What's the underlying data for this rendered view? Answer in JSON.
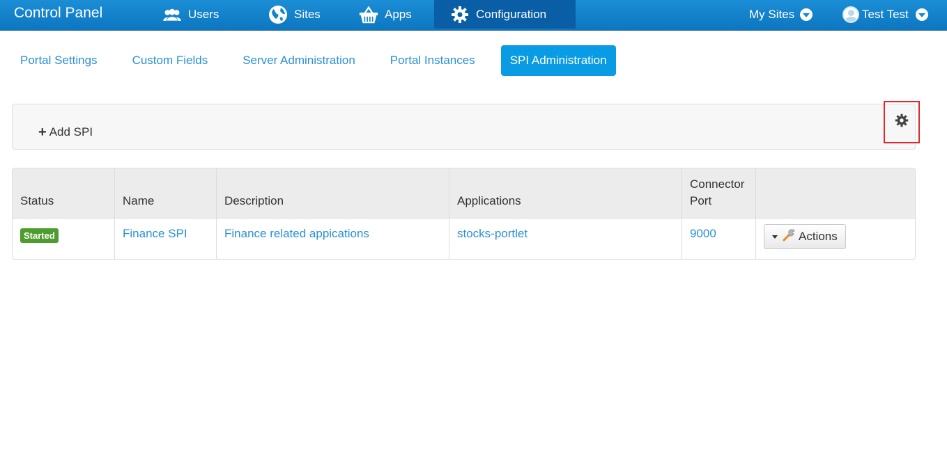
{
  "topbar": {
    "brand": "Control Panel",
    "nav": [
      {
        "label": "Users",
        "icon": "users-icon"
      },
      {
        "label": "Sites",
        "icon": "globe-icon"
      },
      {
        "label": "Apps",
        "icon": "basket-icon"
      },
      {
        "label": "Configuration",
        "icon": "gear-icon",
        "active": true
      }
    ],
    "my_sites": "My Sites",
    "user_name": "Test Test"
  },
  "tabs": [
    {
      "label": "Portal Settings"
    },
    {
      "label": "Custom Fields"
    },
    {
      "label": "Server Administration"
    },
    {
      "label": "Portal Instances"
    },
    {
      "label": "SPI Administration",
      "active": true
    }
  ],
  "toolbar": {
    "add_label": "Add SPI",
    "settings_icon": "gear-icon"
  },
  "table": {
    "headers": [
      "Status",
      "Name",
      "Description",
      "Applications",
      "Connector Port",
      ""
    ],
    "rows": [
      {
        "status": "Started",
        "name": "Finance SPI",
        "description": "Finance related appications",
        "applications": "stocks-portlet",
        "port": "9000",
        "actions_label": "Actions"
      }
    ]
  },
  "colors": {
    "topbar": "#1384cc",
    "active_tab": "#0a9be5",
    "link": "#2a90d6",
    "status_started": "#4d9c2d",
    "highlight": "#e0262b"
  }
}
